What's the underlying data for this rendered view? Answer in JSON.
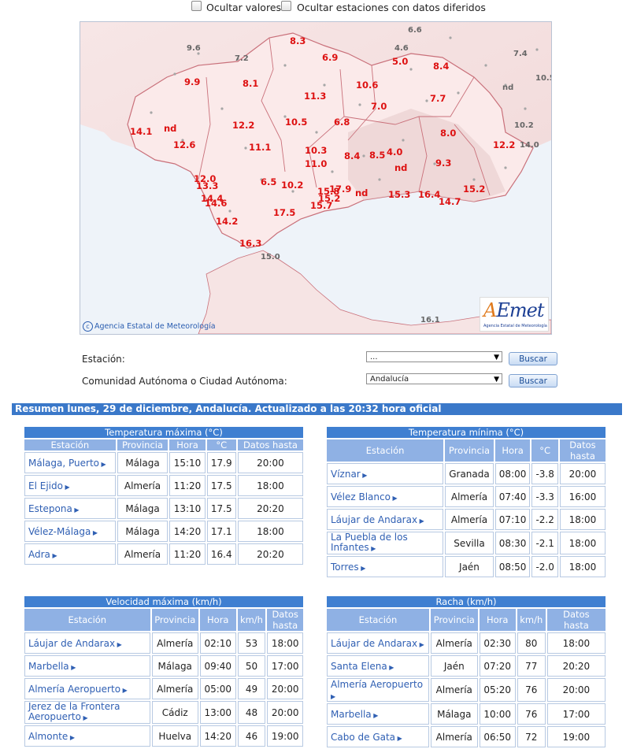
{
  "top": {
    "hide_values_label": "Ocultar valores",
    "hide_deferred_label": "Ocultar estaciones con datos diferidos"
  },
  "map": {
    "copyright": "Agencia Estatal de Meteorología",
    "logo_text": "AEmet",
    "logo_sub": "Agencia Estatal de Meteorología",
    "values_red": [
      "8.3",
      "6.9",
      "5.0",
      "8.4",
      "9.9",
      "8.1",
      "10.6",
      "11.3",
      "7.7",
      "7.0",
      "14.1",
      "nd",
      "12.2",
      "10.5",
      "6.8",
      "8.0",
      "12.6",
      "11.1",
      "12.2",
      "10.3",
      "8.4",
      "8.5",
      "4.0",
      "11.0",
      "nd",
      "9.3",
      "12.0",
      "6.5",
      "10.2",
      "13.3",
      "15.8",
      "17.9",
      "nd",
      "15.3",
      "16.4",
      "15.2",
      "14.4",
      "14.6",
      "15.2",
      "15.7",
      "14.7",
      "17.5",
      "14.2",
      "16.3"
    ],
    "values_gray": [
      "6.6",
      "9.6",
      "7.2",
      "4.6",
      "7.4",
      "10.5",
      "nd",
      "10.2",
      "14.0",
      "15.0",
      "16.1"
    ]
  },
  "form": {
    "station_label": "Estación:",
    "station_value": "...",
    "community_label": "Comunidad Autónoma o Ciudad Autónoma:",
    "community_value": "Andalucía",
    "search_button": "Buscar"
  },
  "summary": "Resumen lunes, 29 de diciembre, Andalucía. Actualizado a las 20:32 hora oficial",
  "tables": {
    "tmax": {
      "title": "Temperatura máxima (°C)",
      "headers": [
        "Estación",
        "Provincia",
        "Hora",
        "°C",
        "Datos hasta"
      ],
      "rows": [
        [
          "Málaga, Puerto",
          "Málaga",
          "15:10",
          "17.9",
          "20:00"
        ],
        [
          "El Ejido",
          "Almería",
          "11:20",
          "17.5",
          "18:00"
        ],
        [
          "Estepona",
          "Málaga",
          "13:10",
          "17.5",
          "20:20"
        ],
        [
          "Vélez-Málaga",
          "Málaga",
          "14:20",
          "17.1",
          "18:00"
        ],
        [
          "Adra",
          "Almería",
          "11:20",
          "16.4",
          "20:20"
        ]
      ]
    },
    "tmin": {
      "title": "Temperatura mínima (°C)",
      "headers": [
        "Estación",
        "Provincia",
        "Hora",
        "°C",
        "Datos hasta"
      ],
      "rows": [
        [
          "Víznar",
          "Granada",
          "08:00",
          "-3.8",
          "20:00"
        ],
        [
          "Vélez Blanco",
          "Almería",
          "07:40",
          "-3.3",
          "16:00"
        ],
        [
          "Láujar de Andarax",
          "Almería",
          "07:10",
          "-2.2",
          "18:00"
        ],
        [
          "La Puebla de los Infantes",
          "Sevilla",
          "08:30",
          "-2.1",
          "18:00"
        ],
        [
          "Torres",
          "Jaén",
          "08:50",
          "-2.0",
          "18:00"
        ]
      ]
    },
    "vmax": {
      "title": "Velocidad máxima (km/h)",
      "headers": [
        "Estación",
        "Provincia",
        "Hora",
        "km/h",
        "Datos hasta"
      ],
      "rows": [
        [
          "Láujar de Andarax",
          "Almería",
          "02:10",
          "53",
          "18:00"
        ],
        [
          "Marbella",
          "Málaga",
          "09:40",
          "50",
          "17:00"
        ],
        [
          "Almería Aeropuerto",
          "Almería",
          "05:00",
          "49",
          "20:00"
        ],
        [
          "Jerez de la Frontera Aeropuerto",
          "Cádiz",
          "13:00",
          "48",
          "20:00"
        ],
        [
          "Almonte",
          "Huelva",
          "14:20",
          "46",
          "19:00"
        ]
      ]
    },
    "racha": {
      "title": "Racha (km/h)",
      "headers": [
        "Estación",
        "Provincia",
        "Hora",
        "km/h",
        "Datos hasta"
      ],
      "rows": [
        [
          "Láujar de Andarax",
          "Almería",
          "02:30",
          "80",
          "18:00"
        ],
        [
          "Santa Elena",
          "Jaén",
          "07:20",
          "77",
          "20:20"
        ],
        [
          "Almería Aeropuerto",
          "Almería",
          "05:20",
          "76",
          "20:00"
        ],
        [
          "Marbella",
          "Málaga",
          "10:00",
          "76",
          "17:00"
        ],
        [
          "Cabo de Gata",
          "Almería",
          "06:50",
          "72",
          "19:00"
        ]
      ]
    }
  }
}
